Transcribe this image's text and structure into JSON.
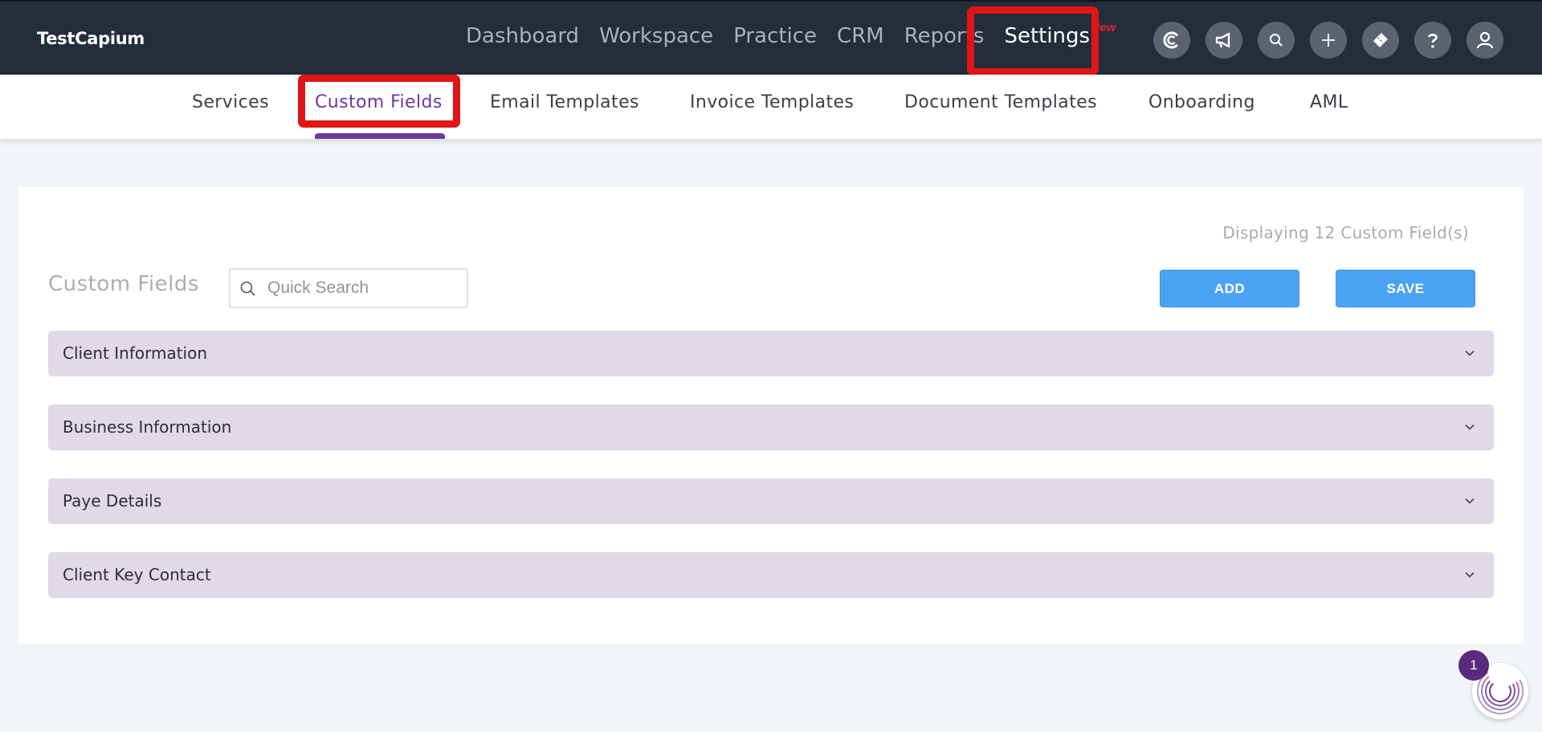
{
  "app": {
    "brand": "TestCapium"
  },
  "main_nav": {
    "items": [
      {
        "label": "Dashboard"
      },
      {
        "label": "Workspace"
      },
      {
        "label": "Practice"
      },
      {
        "label": "CRM"
      },
      {
        "label": "Reports"
      },
      {
        "label": "Settings",
        "active": true,
        "badge": "New"
      }
    ]
  },
  "toolbar_icons": [
    "capium-icon",
    "megaphone-icon",
    "search-icon",
    "plus-icon",
    "ticket-icon",
    "help-icon",
    "user-icon"
  ],
  "sub_nav": {
    "tabs": [
      {
        "label": "Services"
      },
      {
        "label": "Custom Fields",
        "active": true
      },
      {
        "label": "Email Templates"
      },
      {
        "label": "Invoice Templates"
      },
      {
        "label": "Document Templates"
      },
      {
        "label": "Onboarding"
      },
      {
        "label": "AML"
      }
    ]
  },
  "panel": {
    "count_text": "Displaying 12 Custom Field(s)",
    "title": "Custom Fields",
    "search_placeholder": "Quick Search",
    "add_label": "ADD",
    "save_label": "SAVE",
    "sections": [
      {
        "label": "Client Information"
      },
      {
        "label": "Business Information"
      },
      {
        "label": "Paye Details"
      },
      {
        "label": "Client Key Contact"
      }
    ]
  },
  "chat": {
    "count": "1"
  },
  "colors": {
    "topbar": "#242d3a",
    "accent_purple": "#6a3a9e",
    "button_blue": "#4aa3f2",
    "section_bg": "#e0d9e8",
    "highlight_red": "#e01616"
  }
}
